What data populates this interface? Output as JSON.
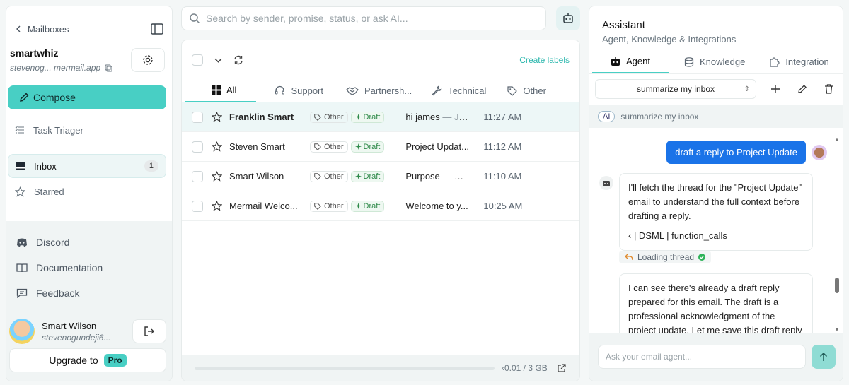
{
  "search": {
    "placeholder": "Search by sender, promise, status, or ask AI..."
  },
  "sidebar": {
    "back_label": "Mailboxes",
    "account_name": "smartwhiz",
    "account_email": "stevenog... mermail.app",
    "compose_label": "Compose",
    "task_triager_label": "Task Triager",
    "inbox_label": "Inbox",
    "inbox_count": "1",
    "starred_label": "Starred",
    "links": {
      "discord": "Discord",
      "documentation": "Documentation",
      "feedback": "Feedback"
    },
    "user_name": "Smart Wilson",
    "user_email": "stevenogundeji6...",
    "upgrade_label": "Upgrade to",
    "pro_label": "Pro"
  },
  "mail": {
    "create_labels": "Create labels",
    "tabs": [
      "All",
      "Support",
      "Partnersh...",
      "Technical",
      "Other"
    ],
    "rows": [
      {
        "sender": "Franklin Smart",
        "tag": "Other",
        "status": "Draft",
        "subject": "hi james",
        "preview": " — Ju...",
        "time": "11:27 AM"
      },
      {
        "sender": "Steven Smart",
        "tag": "Other",
        "status": "Draft",
        "subject": "Project Updat...",
        "preview": "",
        "time": "11:12 AM"
      },
      {
        "sender": "Smart Wilson",
        "tag": "Other",
        "status": "Draft",
        "subject": "Purpose",
        "preview": " — De...",
        "time": "11:10 AM"
      },
      {
        "sender": "Mermail Welco...",
        "tag": "Other",
        "status": "Draft",
        "subject": "Welcome to y...",
        "preview": "",
        "time": "10:25 AM"
      }
    ],
    "storage_text": "‹0.01 / 3 GB",
    "storage_used_fraction": 0.0033
  },
  "assistant": {
    "title": "Assistant",
    "subtitle": "Agent, Knowledge & Integrations",
    "tabs": [
      "Agent",
      "Knowledge",
      "Integration"
    ],
    "thread_select": "summarize my inbox",
    "ai_chip": "AI",
    "ai_text": "summarize my inbox",
    "user_message": "draft a reply to Project Update",
    "bot_message_1": "I'll fetch the thread for the \"Project Update\" email to understand the full context before drafting a reply.",
    "bot_tool_line": "‹ | DSML | function_calls",
    "loading_label": "Loading thread",
    "bot_message_2": "I can see there's already a draft reply prepared for this email. The draft is a professional acknowledgment of the project update. Let me save this draft reply",
    "input_placeholder": "Ask your email agent..."
  },
  "colors": {
    "accent": "#48cfc4",
    "user_bubble": "#1a73e8",
    "draft_green": "#2f8a4a"
  }
}
